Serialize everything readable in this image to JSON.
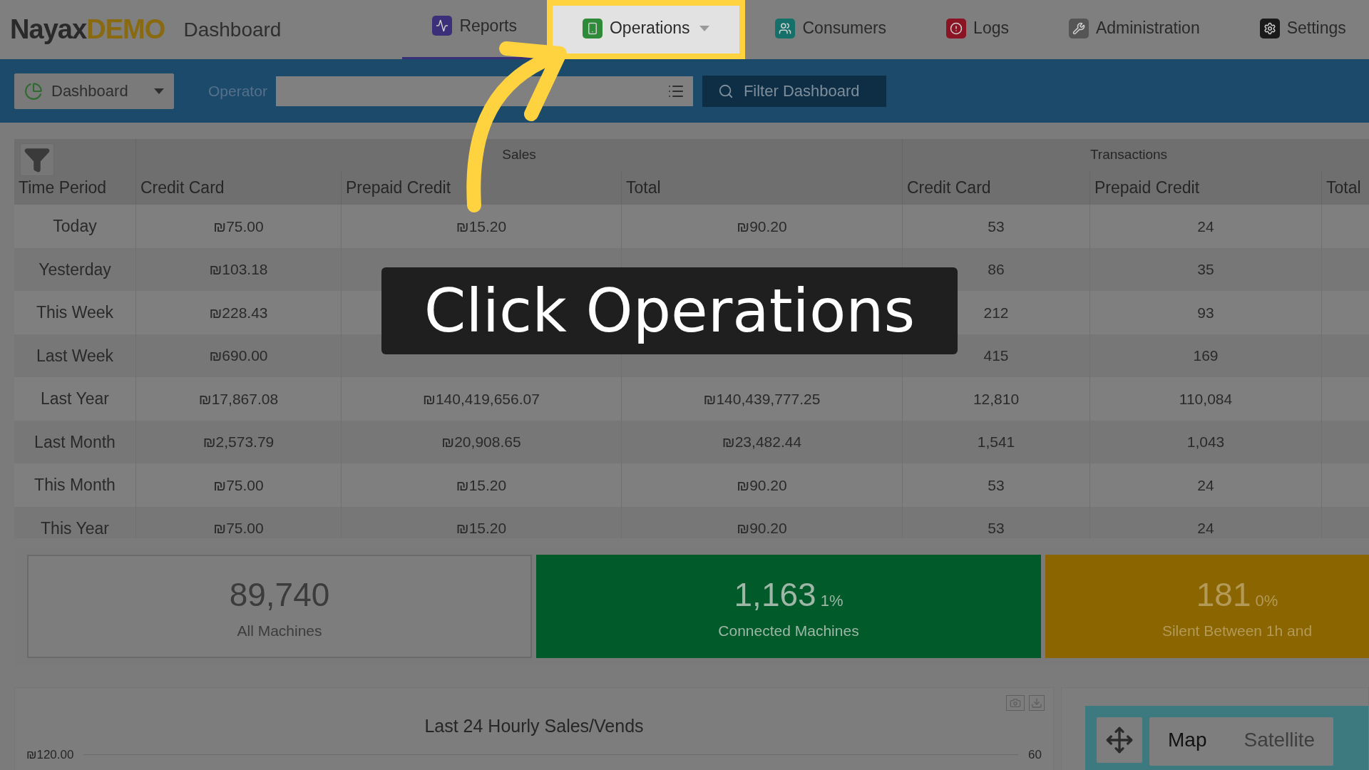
{
  "header": {
    "logo": {
      "brand": "Nayax",
      "suffix": "DEMO"
    },
    "page_title": "Dashboard",
    "nav": [
      {
        "label": "Reports",
        "selected": true,
        "highlighted": false,
        "has_dropdown": false
      },
      {
        "label": "Operations",
        "selected": false,
        "highlighted": true,
        "has_dropdown": true
      },
      {
        "label": "Consumers",
        "selected": false,
        "highlighted": false,
        "has_dropdown": false
      },
      {
        "label": "Logs",
        "selected": false,
        "highlighted": false,
        "has_dropdown": false
      },
      {
        "label": "Administration",
        "selected": false,
        "highlighted": false,
        "has_dropdown": false
      },
      {
        "label": "Settings",
        "selected": false,
        "highlighted": false,
        "has_dropdown": false
      }
    ]
  },
  "toolbar": {
    "dashboard_menu": "Dashboard",
    "operator_label": "Operator",
    "filter_button": "Filter Dashboard"
  },
  "table": {
    "groups": [
      "Sales",
      "Transactions"
    ],
    "columns": [
      "Time Period",
      "Credit Card",
      "Prepaid Credit",
      "Total",
      "Credit Card",
      "Prepaid Credit",
      "Total"
    ],
    "rows": [
      [
        "Today",
        "₪75.00",
        "₪15.20",
        "₪90.20",
        "53",
        "24",
        null
      ],
      [
        "Yesterday",
        "₪103.18",
        null,
        null,
        "86",
        "35",
        null
      ],
      [
        "This Week",
        "₪228.43",
        null,
        null,
        "212",
        "93",
        null
      ],
      [
        "Last Week",
        "₪690.00",
        null,
        null,
        "415",
        "169",
        null
      ],
      [
        "Last Year",
        "₪17,867.08",
        "₪140,419,656.07",
        "₪140,439,777.25",
        "12,810",
        "110,084",
        null
      ],
      [
        "Last Month",
        "₪2,573.79",
        "₪20,908.65",
        "₪23,482.44",
        "1,541",
        "1,043",
        null
      ],
      [
        "This Month",
        "₪75.00",
        "₪15.20",
        "₪90.20",
        "53",
        "24",
        null
      ],
      [
        "This Year",
        "₪75.00",
        "₪15.20",
        "₪90.20",
        "53",
        "24",
        null
      ]
    ]
  },
  "stats": [
    {
      "kind": "all",
      "value": "89,740",
      "label": "All Machines"
    },
    {
      "kind": "connected",
      "value": "1,163",
      "percent": "1%",
      "label": "Connected Machines"
    },
    {
      "kind": "silent",
      "value": "181",
      "percent": "0%",
      "label": "Silent Between 1h and"
    }
  ],
  "chart_panel": {
    "title": "Last 24 Hourly Sales/Vends",
    "left_axis_label": "₪120.00",
    "right_axis_label": "60"
  },
  "map_panel": {
    "types": [
      {
        "label": "Map",
        "selected": true
      },
      {
        "label": "Satellite",
        "selected": false
      }
    ]
  },
  "tutorial": {
    "caption": "Click Operations"
  }
}
